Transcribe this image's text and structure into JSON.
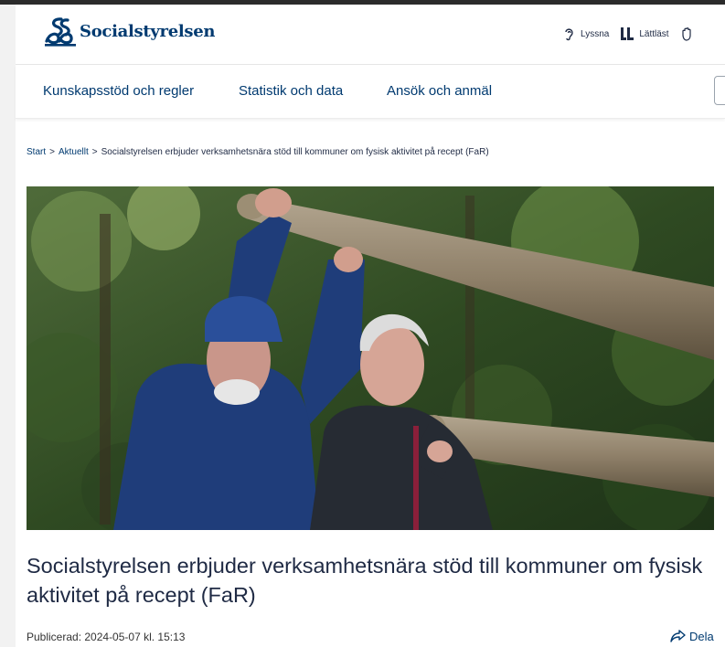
{
  "header": {
    "logo_text": "Socialstyrelsen",
    "tools": [
      {
        "label": "Lyssna",
        "icon": "ear-icon"
      },
      {
        "label": "Lättläst",
        "icon": "easy-read-icon"
      },
      {
        "label": "",
        "icon": "sign-language-icon"
      }
    ]
  },
  "nav": {
    "items": [
      "Kunskapsstöd och regler",
      "Statistik och data",
      "Ansök och anmäl"
    ]
  },
  "breadcrumb": {
    "items": [
      "Start",
      "Aktuellt",
      "Socialstyrelsen erbjuder verksamhetsnära stöd till kommuner om fysisk aktivitet på recept (FaR)"
    ],
    "separator": ">"
  },
  "article": {
    "hero_alt": "Two older men exercising with wooden logs outdoors",
    "title": "Socialstyrelsen erbjuder verksamhetsnära stöd till kommuner om fysisk aktivitet på recept (FaR)",
    "published": "Publicerad: 2024-05-07 kl. 15:13",
    "share_label": "Dela"
  },
  "colors": {
    "brand": "#003a70",
    "text": "#1f2a44"
  }
}
